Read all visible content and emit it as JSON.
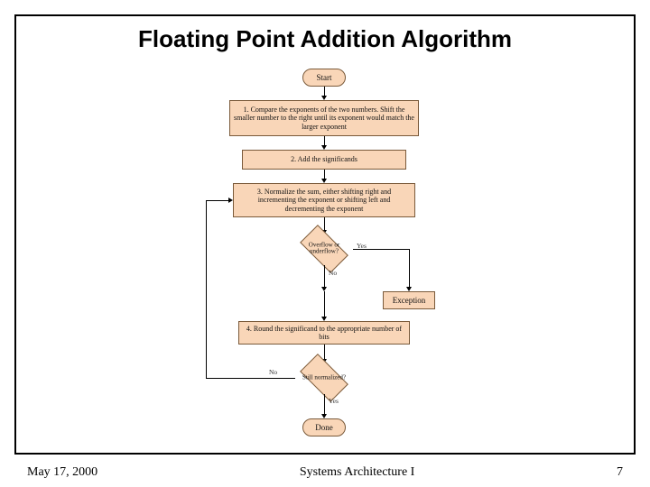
{
  "slide": {
    "title": "Floating Point Addition Algorithm",
    "footer_left": "May 17, 2000",
    "footer_center": "Systems Architecture I",
    "footer_right": "7"
  },
  "flow": {
    "start": "Start",
    "step1": "1. Compare the exponents of the two numbers. Shift the smaller number to the right until its exponent would match the larger exponent",
    "step2": "2. Add the significands",
    "step3": "3. Normalize the sum, either shifting right and incrementing the exponent or shifting left and decrementing the exponent",
    "decision1": "Overflow or underflow?",
    "decision1_yes": "Yes",
    "decision1_no": "No",
    "exception": "Exception",
    "step4": "4. Round the significand to the appropriate number of bits",
    "decision2": "Still normalized?",
    "decision2_yes": "Yes",
    "decision2_no": "No",
    "done": "Done"
  }
}
